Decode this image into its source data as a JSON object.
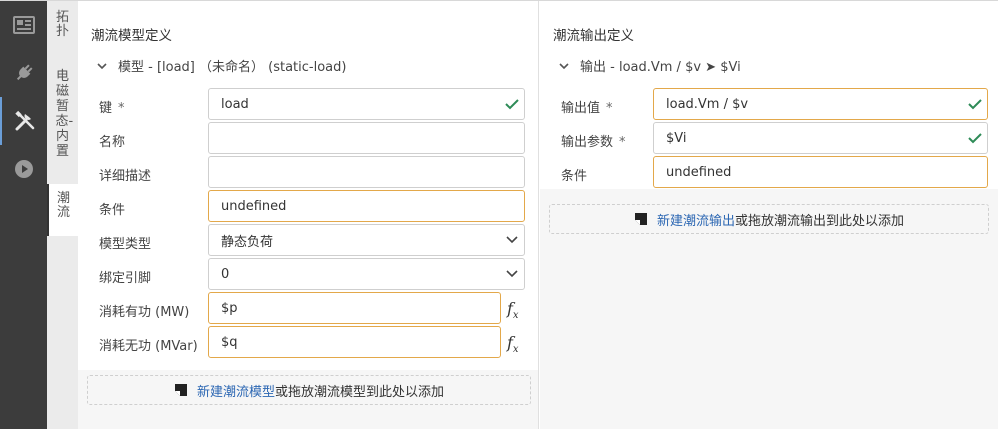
{
  "vtabs": {
    "topology": "拓扑",
    "emt_builtin": "电磁暂态-内置",
    "powerflow": "潮流"
  },
  "left": {
    "title": "潮流模型定义",
    "section": "模型 - [load] （未命名） (static-load)",
    "fields": {
      "key": {
        "label": "键",
        "required": "*",
        "value": "load"
      },
      "name": {
        "label": "名称",
        "value": ""
      },
      "desc": {
        "label": "详细描述",
        "value": ""
      },
      "condition": {
        "label": "条件",
        "value": "undefined"
      },
      "model_type": {
        "label": "模型类型",
        "value": "静态负荷"
      },
      "pin": {
        "label": "绑定引脚",
        "value": "0"
      },
      "p": {
        "label": "消耗有功 (MW)",
        "value": "$p"
      },
      "q": {
        "label": "消耗无功 (MVar)",
        "value": "$q"
      }
    },
    "dropzone": {
      "link": "新建潮流模型",
      "rest": "或拖放潮流模型到此处以添加"
    }
  },
  "right": {
    "title": "潮流输出定义",
    "section": "输出 - load.Vm / $v ➤ $Vi",
    "fields": {
      "output_value": {
        "label": "输出值",
        "required": "*",
        "value": "load.Vm / $v"
      },
      "output_param": {
        "label": "输出参数",
        "required": "*",
        "value": "$Vi"
      },
      "condition": {
        "label": "条件",
        "value": "undefined"
      }
    },
    "dropzone": {
      "link": "新建潮流输出",
      "rest": "或拖放潮流输出到此处以添加"
    }
  },
  "colors": {
    "accent_border": "#e3a84a",
    "check": "#2e8b57",
    "link": "#2c67b3",
    "rail": "#3c3c3c"
  }
}
